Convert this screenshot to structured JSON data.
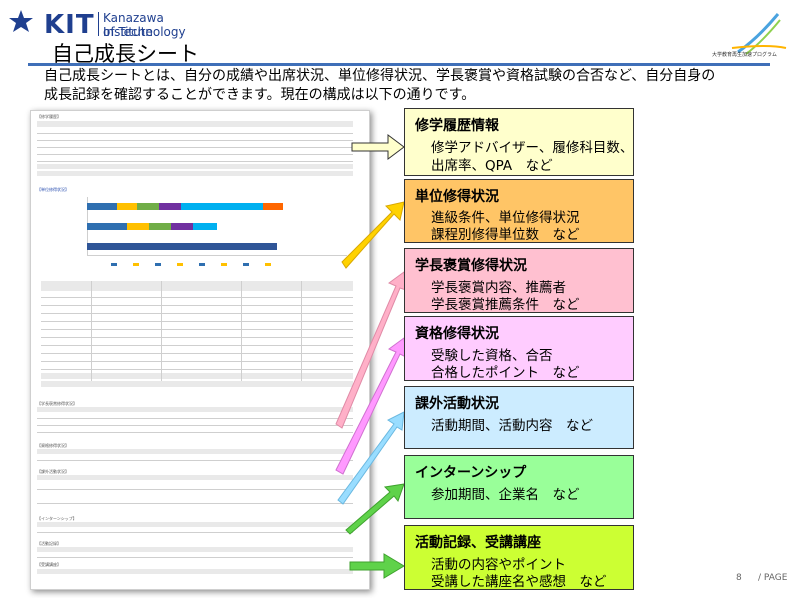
{
  "header": {
    "logo_kit": "KIT",
    "logo_name_line1": "Kanazawa Institute",
    "logo_name_line2": "of Technology",
    "page_title": "自己成長シート",
    "corner_caption": "大学教育再生加速プログラム"
  },
  "intro": {
    "line1": "自己成長シートとは、自分の成績や出席状況、単位修得状況、学長褒賞や資格試験の合否など、自分自身の",
    "line2": "成長記録を確認することができます。現在の構成は以下の通りです。"
  },
  "callouts": [
    {
      "title": "修学履歴情報",
      "lines": [
        "修学アドバイザー、履修科目数、",
        "出席率、QPA　など"
      ],
      "color": "#ffffcc"
    },
    {
      "title": "単位修得状況",
      "lines": [
        "進級条件、単位修得状況",
        "課程別修得単位数　など"
      ],
      "color": "#ffc566"
    },
    {
      "title": "学長褒賞修得状況",
      "lines": [
        "学長褒賞内容、推薦者",
        "学長褒賞推薦条件　など"
      ],
      "color": "#ffc0d0"
    },
    {
      "title": "資格修得状況",
      "lines": [
        "受験した資格、合否",
        "合格したポイント　など"
      ],
      "color": "#ffccff"
    },
    {
      "title": "課外活動状況",
      "lines": [
        "活動期間、活動内容　など"
      ],
      "color": "#ccecff"
    },
    {
      "title": "インターンシップ",
      "lines": [
        "参加期間、企業名　など"
      ],
      "color": "#99ff99"
    },
    {
      "title": "活動記録、受講講座",
      "lines": [
        "活動の内容やポイント",
        "受講した講座名や感想　など"
      ],
      "color": "#ccff33"
    }
  ],
  "document": {
    "section1_label": "【修学履歴】",
    "section2_label": "【単位修得状況】",
    "section3_label": "【学長褒賞修得状況】",
    "section4_label": "【資格修得状況】",
    "section5_label": "【課外活動状況】",
    "section6_label": "【インターンシップ】",
    "section7_label": "【活動記録】"
  },
  "footer": {
    "page_number": "8",
    "page_label": "/ PAGE"
  },
  "colors": {
    "title_rule": "#3f6fb8",
    "arrow_green": "#5fd24a",
    "arrow_yellow": "#ffd200",
    "arrow_pink": "#ffb0c8",
    "arrow_magenta": "#ff99ff",
    "arrow_cyan": "#99ddff"
  }
}
